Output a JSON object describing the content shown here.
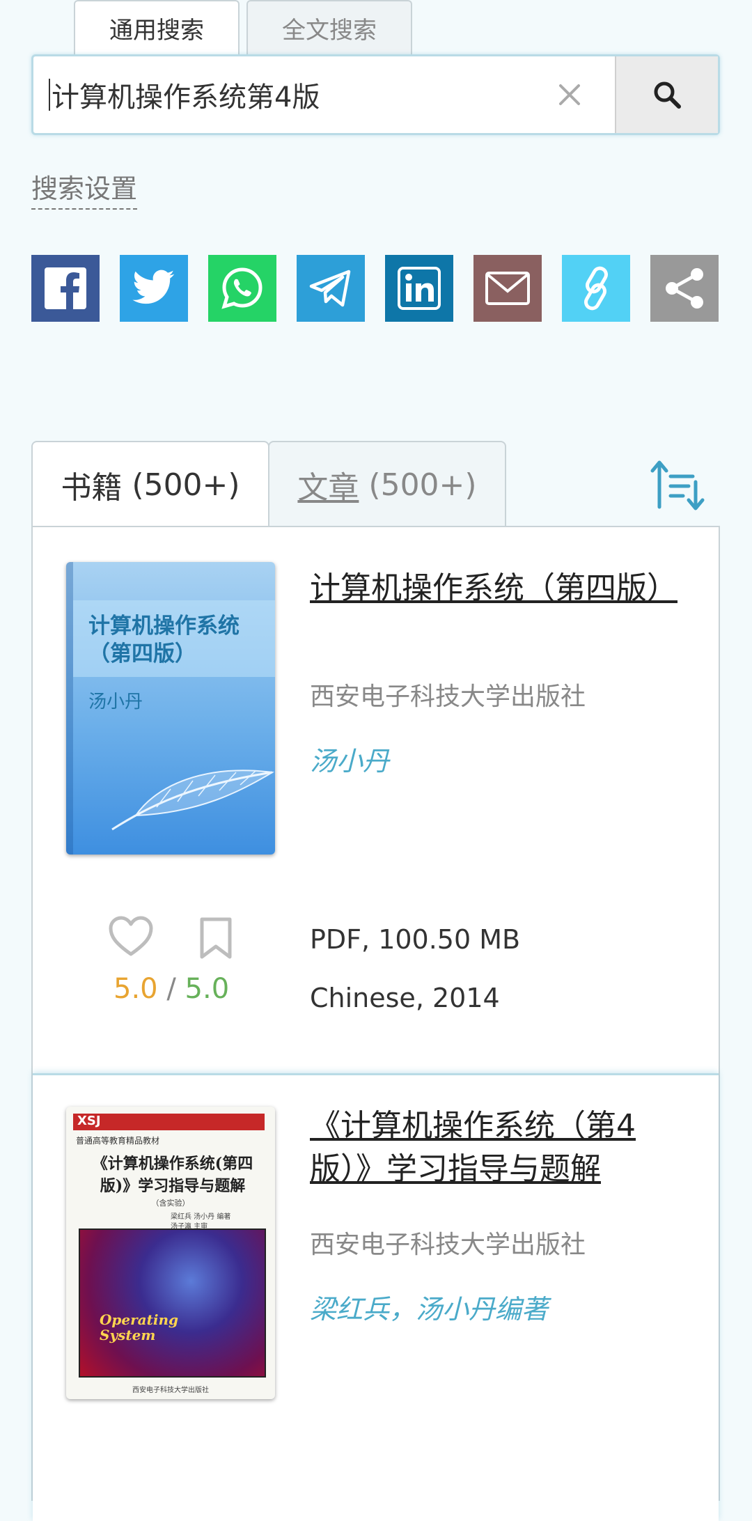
{
  "search_tabs": [
    {
      "label": "通用搜索"
    },
    {
      "label": "全文搜索"
    }
  ],
  "search": {
    "value": "计算机操作系统第4版"
  },
  "settings_label": "搜索设置",
  "share": [
    {
      "name": "facebook",
      "color": "#3b5998"
    },
    {
      "name": "twitter",
      "color": "#2ea3e6"
    },
    {
      "name": "whatsapp",
      "color": "#25d366"
    },
    {
      "name": "telegram",
      "color": "#2d9fd8"
    },
    {
      "name": "linkedin",
      "color": "#0e76a8"
    },
    {
      "name": "email",
      "color": "#8a6060"
    },
    {
      "name": "copy-link",
      "color": "#52d1f5"
    },
    {
      "name": "share",
      "color": "#999999"
    }
  ],
  "result_tabs": {
    "books": {
      "label": "书籍",
      "count": "(500+)"
    },
    "articles": {
      "label": "文章",
      "count": "(500+)"
    }
  },
  "results": [
    {
      "title": "计算机操作系统（第四版）",
      "publisher": "西安电子科技大学出版社",
      "authors": "汤小丹",
      "cover": {
        "title_line1": "计算机操作系统",
        "title_line2": "（第四版）",
        "author": "汤小丹"
      },
      "rating": {
        "a": "5.0",
        "sep": "/",
        "b": "5.0"
      },
      "format": "PDF, 100.50 MB",
      "lang_year": "Chinese, 2014"
    },
    {
      "title": "《计算机操作系统（第4版）》学习指导与题解",
      "publisher": "西安电子科技大学出版社",
      "authors": "梁红兵，汤小丹编著",
      "cover": {
        "brand": "XSJ",
        "series": "普通高等教育精品教材",
        "title": "《计算机操作系统(第四版)》学习指导与题解",
        "note": "（含实验）",
        "authors_line1": "梁红兵   汤小丹  编著",
        "authors_line2": "汤子瀛  主审",
        "os_line1": "Operating",
        "os_line2": "System",
        "footer": "西安电子科技大学出版社"
      }
    }
  ]
}
